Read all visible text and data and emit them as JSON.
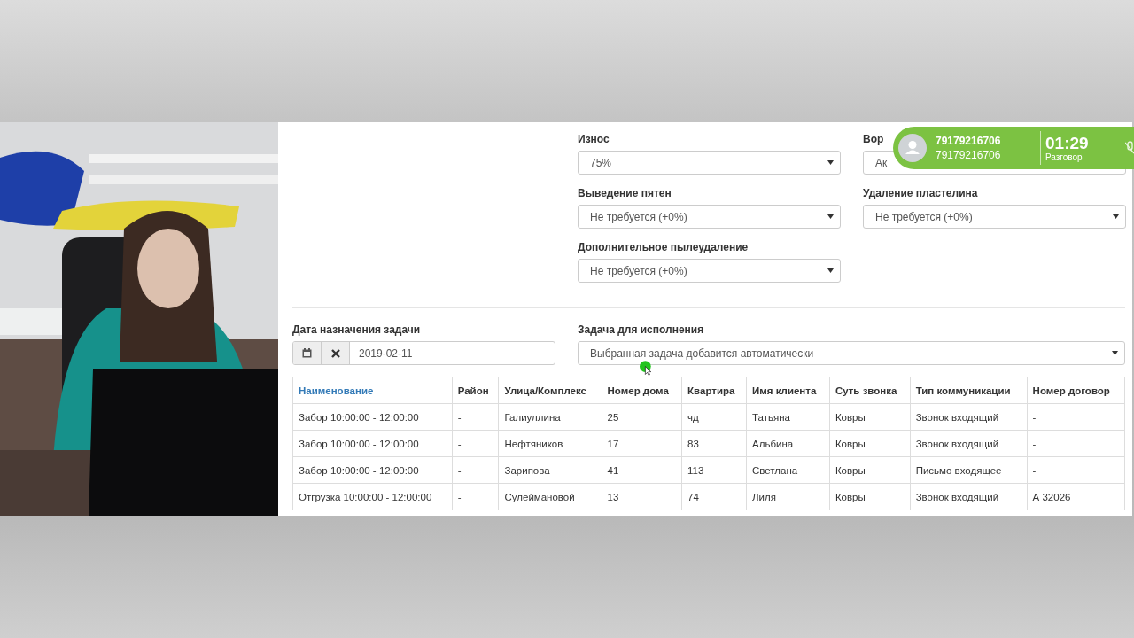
{
  "fields": [
    {
      "label": "Износ",
      "value": "75%"
    },
    {
      "label": "Вор",
      "value": "Ак"
    },
    {
      "label": "Выведение пятен",
      "value": "Не требуется (+0%)"
    },
    {
      "label": "Удаление пластелина",
      "value": "Не требуется (+0%)"
    },
    {
      "label": "Дополнительное пылеудаление",
      "value": "Не требуется (+0%)"
    }
  ],
  "date_field": {
    "label": "Дата назначения задачи",
    "value": "2019-02-11"
  },
  "task_field": {
    "label": "Задача для исполнения",
    "value": "Выбранная задача добавится автоматически"
  },
  "table": {
    "columns": [
      {
        "label": "Наименование",
        "sorted": true
      },
      {
        "label": "Район",
        "sorted": false
      },
      {
        "label": "Улица/Комплекс",
        "sorted": false
      },
      {
        "label": "Номер дома",
        "sorted": false
      },
      {
        "label": "Квартира",
        "sorted": false
      },
      {
        "label": "Имя клиента",
        "sorted": false
      },
      {
        "label": "Суть звонка",
        "sorted": false
      },
      {
        "label": "Тип коммуникации",
        "sorted": false
      },
      {
        "label": "Номер договор",
        "sorted": false
      }
    ],
    "rows": [
      [
        "Забор 10:00:00 - 12:00:00",
        "-",
        "Галиуллина",
        "25",
        "чд",
        "Татьяна",
        "Ковры",
        "Звонок входящий",
        "-"
      ],
      [
        "Забор 10:00:00 - 12:00:00",
        "-",
        "Нефтяников",
        "17",
        "83",
        "Альбина",
        "Ковры",
        "Звонок входящий",
        "-"
      ],
      [
        "Забор 10:00:00 - 12:00:00",
        "-",
        "Зарипова",
        "41",
        "113",
        "Светлана",
        "Ковры",
        "Письмо входящее",
        "-"
      ],
      [
        "Отгрузка 10:00:00 - 12:00:00",
        "-",
        "Сулеймановой",
        "13",
        "74",
        "Лиля",
        "Ковры",
        "Звонок входящий",
        "А 32026"
      ]
    ]
  },
  "call": {
    "number": "79179216706",
    "subtitle": "79179216706",
    "time": "01:29",
    "status": "Разговор"
  }
}
